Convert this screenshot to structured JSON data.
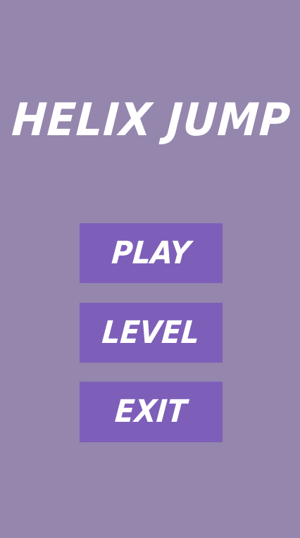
{
  "title": "HELIX JUMP",
  "menu": {
    "play_label": "PLAY",
    "level_label": "LEVEL",
    "exit_label": "EXIT"
  },
  "colors": {
    "background": "#9486ad",
    "button_fill": "#7d5fb9",
    "text": "#ffffff"
  }
}
